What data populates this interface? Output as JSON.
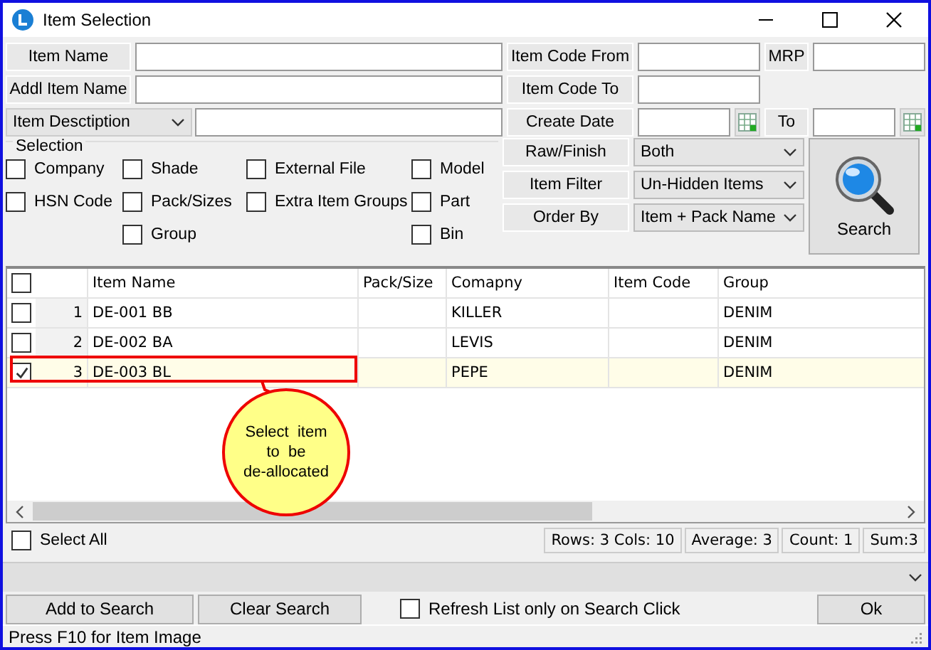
{
  "window": {
    "title": "Item Selection"
  },
  "form": {
    "item_name": {
      "label": "Item Name"
    },
    "addl_item_name": {
      "label": "Addl Item Name"
    },
    "description_dropdown": {
      "value": "Item Desctiption"
    },
    "item_code_from": {
      "label": "Item Code From"
    },
    "mrp": {
      "label": "MRP"
    },
    "item_code_to": {
      "label": "Item Code To"
    },
    "create_date": {
      "label": "Create Date"
    },
    "to_date": {
      "label": "To"
    }
  },
  "selection": {
    "title": "Selection",
    "columns": [
      [
        {
          "label": "Company",
          "checked": false
        },
        {
          "label": "HSN Code",
          "checked": false
        }
      ],
      [
        {
          "label": "Shade",
          "checked": false
        },
        {
          "label": "Pack/Sizes",
          "checked": false
        },
        {
          "label": "Group",
          "checked": false
        }
      ],
      [
        {
          "label": "External File",
          "checked": false
        },
        {
          "label": "Extra Item Groups",
          "checked": false
        }
      ],
      [
        {
          "label": "Model",
          "checked": false
        },
        {
          "label": "Part",
          "checked": false
        },
        {
          "label": "Bin",
          "checked": false
        }
      ]
    ]
  },
  "filters": [
    {
      "label": "Raw/Finish",
      "value": "Both"
    },
    {
      "label": "Item Filter",
      "value": "Un-Hidden Items"
    },
    {
      "label": "Order By",
      "value": "Item + Pack  Name"
    }
  ],
  "search_button": {
    "label": "Search"
  },
  "table": {
    "header_checked": false,
    "columns": [
      "Item Name",
      "Pack/Size",
      "Comapny",
      "Item Code",
      "Group"
    ],
    "rows": [
      {
        "checked": false,
        "selected": false,
        "number": "1",
        "cells": [
          "DE-001 BB",
          "",
          "KILLER",
          "",
          "DENIM"
        ]
      },
      {
        "checked": false,
        "selected": false,
        "number": "2",
        "cells": [
          "DE-002 BA",
          "",
          "LEVIS",
          "",
          "DENIM"
        ]
      },
      {
        "checked": true,
        "selected": true,
        "number": "3",
        "cells": [
          "DE-003 BL",
          "",
          "PEPE",
          "",
          "DENIM"
        ]
      }
    ]
  },
  "callout": {
    "lines": [
      "Select  item",
      "to  be",
      "de-allocated"
    ]
  },
  "select_all": {
    "label": "Select All",
    "checked": false
  },
  "stats": [
    "Rows: 3  Cols: 10",
    "Average: 3",
    "Count: 1",
    "Sum:3"
  ],
  "buttons": {
    "add": "Add to Search",
    "clear": "Clear Search",
    "ok": "Ok"
  },
  "refresh_option": {
    "label": "Refresh List only on Search Click",
    "checked": false
  },
  "status_bar": {
    "text": "Press F10 for Item Image"
  }
}
